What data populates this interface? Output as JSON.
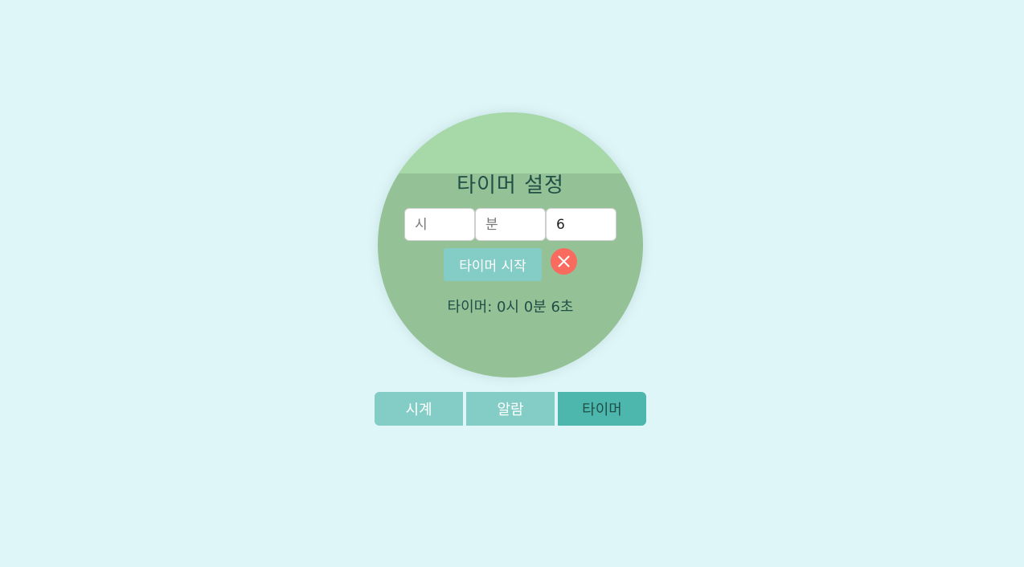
{
  "timer": {
    "title": "타이머 설정",
    "hours_placeholder": "시",
    "minutes_placeholder": "분",
    "seconds_value": "6",
    "start_label": "타이머 시작",
    "cancel_icon": "close-icon",
    "readout": "타이머: 0시 0분 6초"
  },
  "tabs": [
    {
      "label": "시계",
      "active": false
    },
    {
      "label": "알람",
      "active": false
    },
    {
      "label": "타이머",
      "active": true
    }
  ],
  "colors": {
    "background": "#dff6f8",
    "circle": "#95c196",
    "circle_band": "#a6d8a8",
    "button": "#84ccc6",
    "active_tab": "#4db7ad",
    "cancel": "#f96a5f"
  }
}
